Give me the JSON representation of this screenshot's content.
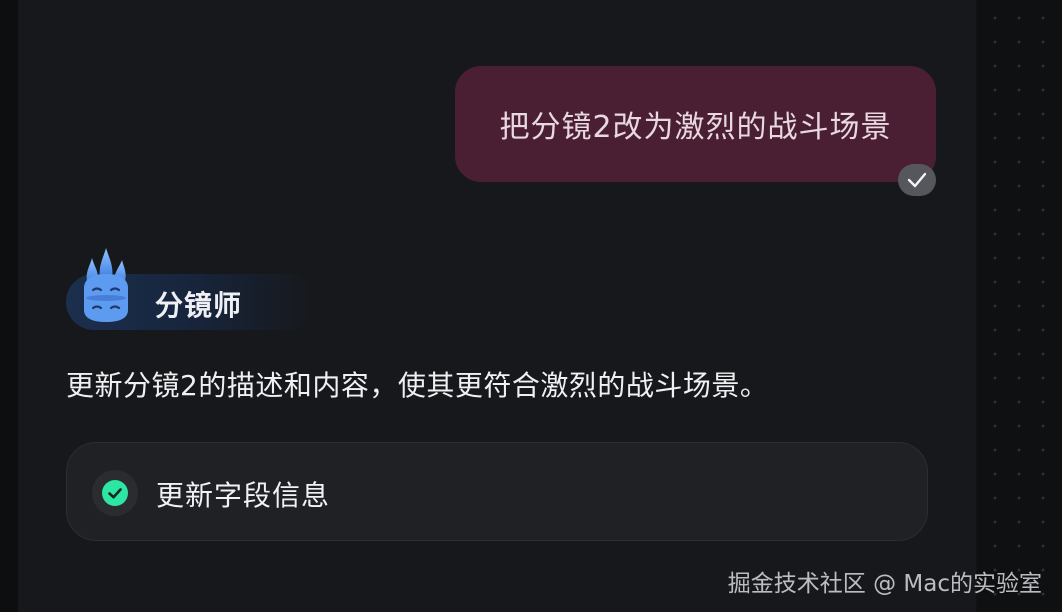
{
  "user_message": {
    "text": "把分镜2改为激烈的战斗场景",
    "status": "read",
    "bubble_color": "#4b1f33"
  },
  "agent": {
    "name": "分镜师",
    "avatar_icon": "blue-flame-mascot-icon",
    "reply": "更新分镜2的描述和内容，使其更符合激烈的战斗场景。"
  },
  "tool_call": {
    "label": "更新字段信息",
    "status": "completed",
    "status_color": "#2ee6a4"
  },
  "watermark": "掘金技术社区 @ Mac的实验室"
}
